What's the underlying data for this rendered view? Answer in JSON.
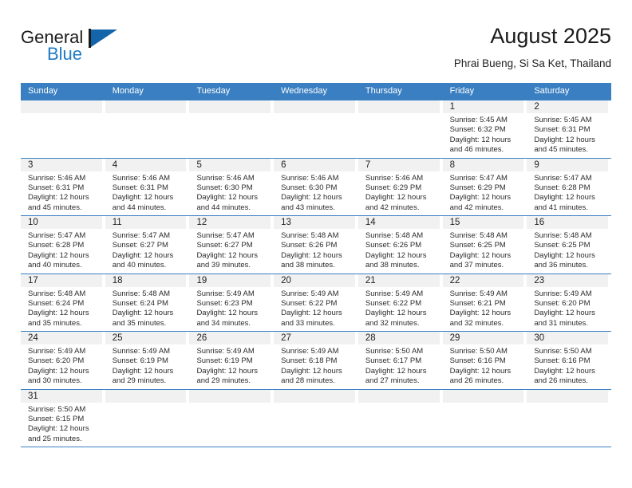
{
  "brand": {
    "name_top": "General",
    "name_bottom": "Blue",
    "accent_color": "#1464aa",
    "text_color": "#1b1b1b"
  },
  "header": {
    "title": "August 2025",
    "subtitle": "Phrai Bueng, Si Sa Ket, Thailand"
  },
  "theme": {
    "header_blue": "#3a7fc1",
    "day_band_gray": "#f1f1f1",
    "rule_blue": "#3a7fc1"
  },
  "weekdays": [
    "Sunday",
    "Monday",
    "Tuesday",
    "Wednesday",
    "Thursday",
    "Friday",
    "Saturday"
  ],
  "weeks": [
    [
      {
        "day": "",
        "lines": []
      },
      {
        "day": "",
        "lines": []
      },
      {
        "day": "",
        "lines": []
      },
      {
        "day": "",
        "lines": []
      },
      {
        "day": "",
        "lines": []
      },
      {
        "day": "1",
        "lines": [
          "Sunrise: 5:45 AM",
          "Sunset: 6:32 PM",
          "Daylight: 12 hours",
          "and 46 minutes."
        ]
      },
      {
        "day": "2",
        "lines": [
          "Sunrise: 5:45 AM",
          "Sunset: 6:31 PM",
          "Daylight: 12 hours",
          "and 45 minutes."
        ]
      }
    ],
    [
      {
        "day": "3",
        "lines": [
          "Sunrise: 5:46 AM",
          "Sunset: 6:31 PM",
          "Daylight: 12 hours",
          "and 45 minutes."
        ]
      },
      {
        "day": "4",
        "lines": [
          "Sunrise: 5:46 AM",
          "Sunset: 6:31 PM",
          "Daylight: 12 hours",
          "and 44 minutes."
        ]
      },
      {
        "day": "5",
        "lines": [
          "Sunrise: 5:46 AM",
          "Sunset: 6:30 PM",
          "Daylight: 12 hours",
          "and 44 minutes."
        ]
      },
      {
        "day": "6",
        "lines": [
          "Sunrise: 5:46 AM",
          "Sunset: 6:30 PM",
          "Daylight: 12 hours",
          "and 43 minutes."
        ]
      },
      {
        "day": "7",
        "lines": [
          "Sunrise: 5:46 AM",
          "Sunset: 6:29 PM",
          "Daylight: 12 hours",
          "and 42 minutes."
        ]
      },
      {
        "day": "8",
        "lines": [
          "Sunrise: 5:47 AM",
          "Sunset: 6:29 PM",
          "Daylight: 12 hours",
          "and 42 minutes."
        ]
      },
      {
        "day": "9",
        "lines": [
          "Sunrise: 5:47 AM",
          "Sunset: 6:28 PM",
          "Daylight: 12 hours",
          "and 41 minutes."
        ]
      }
    ],
    [
      {
        "day": "10",
        "lines": [
          "Sunrise: 5:47 AM",
          "Sunset: 6:28 PM",
          "Daylight: 12 hours",
          "and 40 minutes."
        ]
      },
      {
        "day": "11",
        "lines": [
          "Sunrise: 5:47 AM",
          "Sunset: 6:27 PM",
          "Daylight: 12 hours",
          "and 40 minutes."
        ]
      },
      {
        "day": "12",
        "lines": [
          "Sunrise: 5:47 AM",
          "Sunset: 6:27 PM",
          "Daylight: 12 hours",
          "and 39 minutes."
        ]
      },
      {
        "day": "13",
        "lines": [
          "Sunrise: 5:48 AM",
          "Sunset: 6:26 PM",
          "Daylight: 12 hours",
          "and 38 minutes."
        ]
      },
      {
        "day": "14",
        "lines": [
          "Sunrise: 5:48 AM",
          "Sunset: 6:26 PM",
          "Daylight: 12 hours",
          "and 38 minutes."
        ]
      },
      {
        "day": "15",
        "lines": [
          "Sunrise: 5:48 AM",
          "Sunset: 6:25 PM",
          "Daylight: 12 hours",
          "and 37 minutes."
        ]
      },
      {
        "day": "16",
        "lines": [
          "Sunrise: 5:48 AM",
          "Sunset: 6:25 PM",
          "Daylight: 12 hours",
          "and 36 minutes."
        ]
      }
    ],
    [
      {
        "day": "17",
        "lines": [
          "Sunrise: 5:48 AM",
          "Sunset: 6:24 PM",
          "Daylight: 12 hours",
          "and 35 minutes."
        ]
      },
      {
        "day": "18",
        "lines": [
          "Sunrise: 5:48 AM",
          "Sunset: 6:24 PM",
          "Daylight: 12 hours",
          "and 35 minutes."
        ]
      },
      {
        "day": "19",
        "lines": [
          "Sunrise: 5:49 AM",
          "Sunset: 6:23 PM",
          "Daylight: 12 hours",
          "and 34 minutes."
        ]
      },
      {
        "day": "20",
        "lines": [
          "Sunrise: 5:49 AM",
          "Sunset: 6:22 PM",
          "Daylight: 12 hours",
          "and 33 minutes."
        ]
      },
      {
        "day": "21",
        "lines": [
          "Sunrise: 5:49 AM",
          "Sunset: 6:22 PM",
          "Daylight: 12 hours",
          "and 32 minutes."
        ]
      },
      {
        "day": "22",
        "lines": [
          "Sunrise: 5:49 AM",
          "Sunset: 6:21 PM",
          "Daylight: 12 hours",
          "and 32 minutes."
        ]
      },
      {
        "day": "23",
        "lines": [
          "Sunrise: 5:49 AM",
          "Sunset: 6:20 PM",
          "Daylight: 12 hours",
          "and 31 minutes."
        ]
      }
    ],
    [
      {
        "day": "24",
        "lines": [
          "Sunrise: 5:49 AM",
          "Sunset: 6:20 PM",
          "Daylight: 12 hours",
          "and 30 minutes."
        ]
      },
      {
        "day": "25",
        "lines": [
          "Sunrise: 5:49 AM",
          "Sunset: 6:19 PM",
          "Daylight: 12 hours",
          "and 29 minutes."
        ]
      },
      {
        "day": "26",
        "lines": [
          "Sunrise: 5:49 AM",
          "Sunset: 6:19 PM",
          "Daylight: 12 hours",
          "and 29 minutes."
        ]
      },
      {
        "day": "27",
        "lines": [
          "Sunrise: 5:49 AM",
          "Sunset: 6:18 PM",
          "Daylight: 12 hours",
          "and 28 minutes."
        ]
      },
      {
        "day": "28",
        "lines": [
          "Sunrise: 5:50 AM",
          "Sunset: 6:17 PM",
          "Daylight: 12 hours",
          "and 27 minutes."
        ]
      },
      {
        "day": "29",
        "lines": [
          "Sunrise: 5:50 AM",
          "Sunset: 6:16 PM",
          "Daylight: 12 hours",
          "and 26 minutes."
        ]
      },
      {
        "day": "30",
        "lines": [
          "Sunrise: 5:50 AM",
          "Sunset: 6:16 PM",
          "Daylight: 12 hours",
          "and 26 minutes."
        ]
      }
    ],
    [
      {
        "day": "31",
        "lines": [
          "Sunrise: 5:50 AM",
          "Sunset: 6:15 PM",
          "Daylight: 12 hours",
          "and 25 minutes."
        ]
      },
      {
        "day": "",
        "lines": []
      },
      {
        "day": "",
        "lines": []
      },
      {
        "day": "",
        "lines": []
      },
      {
        "day": "",
        "lines": []
      },
      {
        "day": "",
        "lines": []
      },
      {
        "day": "",
        "lines": []
      }
    ]
  ]
}
